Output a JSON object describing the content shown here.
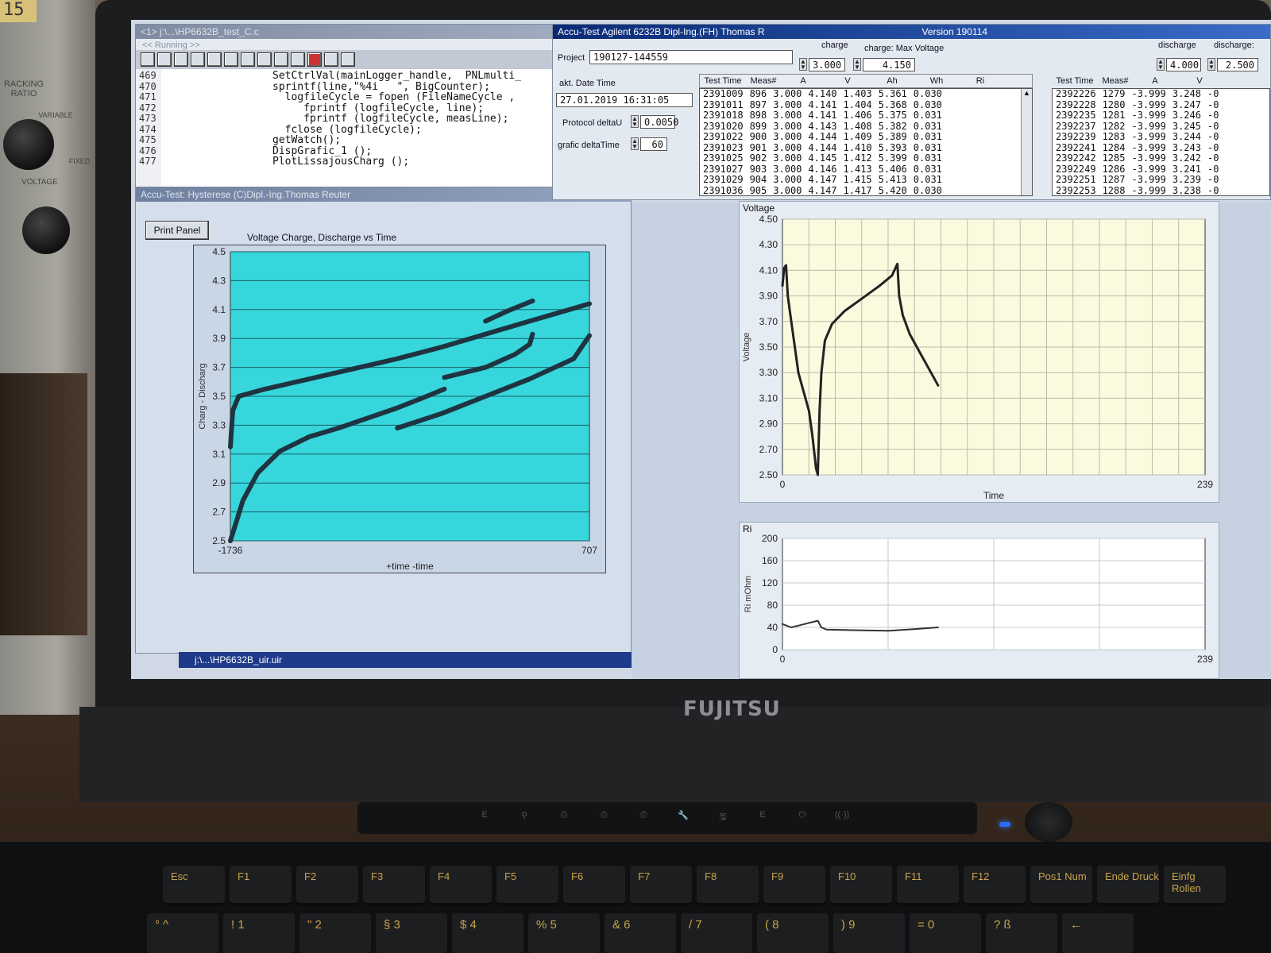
{
  "bench": {
    "readout": "15",
    "label_tracking": "RACKING\nRATIO",
    "label_variable": "VARIABLE",
    "label_fixed": "FIXED",
    "label_voltage": "VOLTAGE"
  },
  "laptop": {
    "brand": "FUJITSU",
    "media_keys": [
      "E",
      "⚲",
      "⎙",
      "⎙",
      "⎙",
      "🔧",
      "🖫",
      "E",
      "⏻",
      "((·))"
    ]
  },
  "keyboard": {
    "fn_row": [
      "Esc",
      "F1",
      "F2",
      "F3",
      "F4",
      "F5",
      "F6",
      "F7",
      "F8",
      "F9",
      "F10",
      "F11",
      "F12",
      "Pos1 Num",
      "Ende Druck",
      "Einfg Rollen"
    ],
    "num_row": [
      "° ^",
      "! 1",
      "\" 2",
      "§ 3",
      "$ 4",
      "% 5",
      "& 6",
      "/ 7",
      "( 8",
      ") 9",
      "= 0",
      "? ß",
      "←"
    ]
  },
  "code_window": {
    "title": "<1> j:\\...\\HP6632B_test_C.c",
    "status": "<< Running >>",
    "line_numbers": [
      "469",
      "470",
      "471",
      "472",
      "473",
      "474",
      "475",
      "476",
      "477"
    ],
    "lines": [
      "SetCtrlVal(mainLogger_handle,  PNLmulti_",
      "sprintf(line,\"%4i   \", BigCounter);",
      "  logfileCycle = fopen (FileNameCycle ,",
      "     fprintf (logfileCycle, line);",
      "     fprintf (logfileCycle, measLine);",
      "  fclose (logfileCycle);",
      "getWatch();",
      "DispGrafic_1 ();",
      "PlotLissajousCharg ();"
    ]
  },
  "hysterese_window": {
    "title": "Accu-Test: Hysterese (C)Dipl.-Ing.Thomas Reuter",
    "print_button": "Print Panel",
    "chart_title": "Voltage Charge, Discharge vs Time",
    "taskbar_item": "j:\\...\\HP6632B_uir.uir"
  },
  "main_window": {
    "title": "Accu-Test Agilent 6232B Dipl-Ing.(FH) Thomas R",
    "version": "Version 190114",
    "project_label": "Project",
    "project_value": "190127-144559",
    "akt_label": "akt. Date Time",
    "datetime_value": "27.01.2019 16:31:05",
    "protocol_label": "Protocol deltaU",
    "protocol_value": "0.0050",
    "grafic_label": "grafic deltaTime",
    "grafic_value": "60",
    "charge_label": "charge",
    "charge_value": "3.000",
    "charge_max_label": "charge: Max Voltage",
    "charge_max_value": "4.150",
    "discharge_label": "discharge",
    "discharge_value": "4.000",
    "discharge_min_label": "discharge:",
    "discharge_min_value": "2.500",
    "charge_table": {
      "headers": [
        "Test Time",
        "Meas#",
        "A",
        "V",
        "Ah",
        "Wh",
        "Ri"
      ],
      "rows": [
        [
          "2391009",
          "896",
          "3.000",
          "4.140",
          "1.403",
          "5.361",
          "0.030"
        ],
        [
          "2391011",
          "897",
          "3.000",
          "4.141",
          "1.404",
          "5.368",
          "0.030"
        ],
        [
          "2391018",
          "898",
          "3.000",
          "4.141",
          "1.406",
          "5.375",
          "0.031"
        ],
        [
          "2391020",
          "899",
          "3.000",
          "4.143",
          "1.408",
          "5.382",
          "0.031"
        ],
        [
          "2391022",
          "900",
          "3.000",
          "4.144",
          "1.409",
          "5.389",
          "0.031"
        ],
        [
          "2391023",
          "901",
          "3.000",
          "4.144",
          "1.410",
          "5.393",
          "0.031"
        ],
        [
          "2391025",
          "902",
          "3.000",
          "4.145",
          "1.412",
          "5.399",
          "0.031"
        ],
        [
          "2391027",
          "903",
          "3.000",
          "4.146",
          "1.413",
          "5.406",
          "0.031"
        ],
        [
          "2391029",
          "904",
          "3.000",
          "4.147",
          "1.415",
          "5.413",
          "0.031"
        ],
        [
          "2391036",
          "905",
          "3.000",
          "4.147",
          "1.417",
          "5.420",
          "0.030"
        ]
      ]
    },
    "discharge_table": {
      "headers": [
        "Test Time",
        "Meas#",
        "A",
        "V"
      ],
      "rows": [
        [
          "2392226",
          "1279",
          "-3.999",
          "3.248",
          "-0"
        ],
        [
          "2392228",
          "1280",
          "-3.999",
          "3.247",
          "-0"
        ],
        [
          "2392235",
          "1281",
          "-3.999",
          "3.246",
          "-0"
        ],
        [
          "2392237",
          "1282",
          "-3.999",
          "3.245",
          "-0"
        ],
        [
          "2392239",
          "1283",
          "-3.999",
          "3.244",
          "-0"
        ],
        [
          "2392241",
          "1284",
          "-3.999",
          "3.243",
          "-0"
        ],
        [
          "2392242",
          "1285",
          "-3.999",
          "3.242",
          "-0"
        ],
        [
          "2392249",
          "1286",
          "-3.999",
          "3.241",
          "-0"
        ],
        [
          "2392251",
          "1287",
          "-3.999",
          "3.239",
          "-0"
        ],
        [
          "2392253",
          "1288",
          "-3.999",
          "3.238",
          "-0"
        ]
      ]
    }
  },
  "chart_data": [
    {
      "type": "scatter",
      "title": "Voltage Charge, Discharge vs Time",
      "xlabel": "+time -time",
      "ylabel": "Charg - Discharg",
      "xlim": [
        -1736,
        707
      ],
      "ylim": [
        2.5,
        4.5
      ],
      "x_ticks": [
        "-1736",
        "707"
      ],
      "y_ticks": [
        "4.5",
        "4.3",
        "4.1",
        "3.9",
        "3.7",
        "3.5",
        "3.3",
        "3.1",
        "2.9",
        "2.7",
        "2.5"
      ],
      "background": "#36d6dc",
      "series": [
        {
          "points": [
            [
              -1736,
              3.15
            ],
            [
              -1720,
              3.4
            ],
            [
              -1680,
              3.5
            ],
            [
              -1500,
              3.55
            ],
            [
              -1200,
              3.62
            ],
            [
              -900,
              3.69
            ],
            [
              -600,
              3.76
            ],
            [
              -300,
              3.84
            ],
            [
              0,
              3.93
            ],
            [
              300,
              4.02
            ],
            [
              707,
              4.14
            ]
          ]
        },
        {
          "points": [
            [
              -1736,
              2.5
            ],
            [
              -1650,
              2.78
            ],
            [
              -1550,
              2.97
            ],
            [
              -1400,
              3.12
            ],
            [
              -1200,
              3.22
            ],
            [
              -1000,
              3.28
            ],
            [
              -800,
              3.35
            ],
            [
              -600,
              3.42
            ],
            [
              -400,
              3.5
            ],
            [
              -280,
              3.55
            ]
          ]
        },
        {
          "points": [
            [
              -280,
              3.63
            ],
            [
              0,
              3.7
            ],
            [
              200,
              3.79
            ],
            [
              300,
              3.86
            ],
            [
              320,
              3.93
            ]
          ]
        },
        {
          "points": [
            [
              -600,
              3.28
            ],
            [
              -300,
              3.38
            ],
            [
              0,
              3.5
            ],
            [
              300,
              3.62
            ],
            [
              600,
              3.76
            ],
            [
              707,
              3.92
            ]
          ]
        },
        {
          "points": [
            [
              0,
              4.02
            ],
            [
              150,
              4.09
            ],
            [
              320,
              4.16
            ]
          ]
        }
      ]
    },
    {
      "type": "line",
      "title": "Voltage",
      "xlabel": "Time",
      "ylabel": "Voltage",
      "xlim": [
        0,
        239
      ],
      "ylim": [
        2.5,
        4.5
      ],
      "x_ticks": [
        "0",
        "239"
      ],
      "y_ticks": [
        "4.50",
        "4.30",
        "4.10",
        "3.90",
        "3.70",
        "3.50",
        "3.30",
        "3.10",
        "2.90",
        "2.70",
        "2.50"
      ],
      "background": "#fafadf",
      "series": [
        {
          "points": [
            [
              0,
              3.98
            ],
            [
              1,
              4.12
            ],
            [
              2,
              4.14
            ],
            [
              3,
              3.9
            ],
            [
              5,
              3.7
            ],
            [
              7,
              3.5
            ],
            [
              9,
              3.3
            ],
            [
              12,
              3.15
            ],
            [
              15,
              3.0
            ],
            [
              17,
              2.8
            ],
            [
              19,
              2.55
            ],
            [
              20,
              2.5
            ],
            [
              21,
              3.0
            ],
            [
              22,
              3.3
            ],
            [
              24,
              3.55
            ],
            [
              28,
              3.68
            ],
            [
              35,
              3.78
            ],
            [
              45,
              3.88
            ],
            [
              55,
              3.98
            ],
            [
              62,
              4.06
            ],
            [
              65,
              4.15
            ],
            [
              66,
              3.9
            ],
            [
              68,
              3.75
            ],
            [
              72,
              3.6
            ],
            [
              78,
              3.45
            ],
            [
              84,
              3.3
            ],
            [
              88,
              3.2
            ]
          ]
        }
      ]
    },
    {
      "type": "line",
      "title": "Ri",
      "xlabel": "",
      "ylabel": "Ri  mOhm",
      "xlim": [
        0,
        239
      ],
      "ylim": [
        0,
        200
      ],
      "x_ticks": [
        "0",
        "239"
      ],
      "y_ticks": [
        "200",
        "160",
        "120",
        "80",
        "40",
        "0"
      ],
      "background": "#ffffff",
      "series": [
        {
          "points": [
            [
              0,
              46
            ],
            [
              5,
              40
            ],
            [
              10,
              44
            ],
            [
              15,
              48
            ],
            [
              20,
              52
            ],
            [
              22,
              40
            ],
            [
              25,
              36
            ],
            [
              40,
              35
            ],
            [
              60,
              34
            ],
            [
              75,
              37
            ],
            [
              88,
              40
            ]
          ]
        }
      ]
    }
  ]
}
